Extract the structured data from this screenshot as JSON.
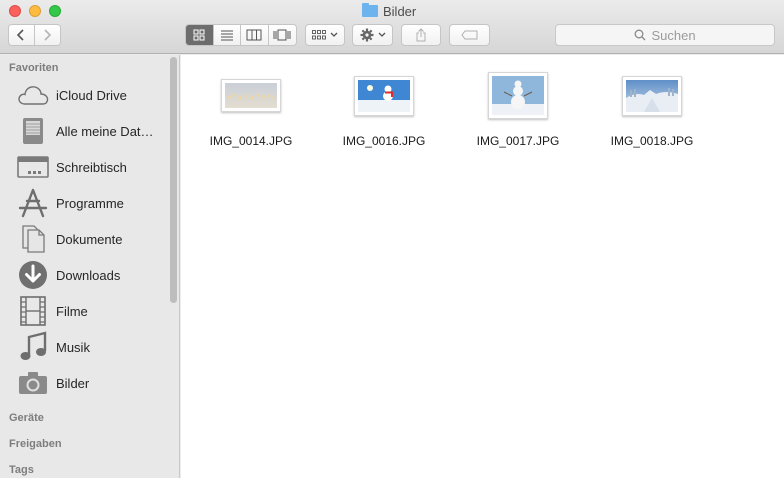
{
  "window": {
    "title": "Bilder"
  },
  "toolbar": {
    "back_icon": "chevron-left-icon",
    "forward_icon": "chevron-right-icon",
    "views": [
      "icon-view",
      "list-view",
      "column-view",
      "coverflow-view"
    ],
    "arrange_icon": "arrange-grid-icon",
    "action_icon": "gear-icon",
    "share_icon": "share-icon",
    "tag_icon": "tag-icon",
    "search_placeholder": "Suchen"
  },
  "sidebar": {
    "favorites_label": "Favoriten",
    "items": [
      {
        "label": "iCloud Drive",
        "icon": "cloud-icon"
      },
      {
        "label": "Alle meine Dat…",
        "icon": "all-files-icon"
      },
      {
        "label": "Schreibtisch",
        "icon": "desktop-icon"
      },
      {
        "label": "Programme",
        "icon": "applications-icon"
      },
      {
        "label": "Dokumente",
        "icon": "documents-icon"
      },
      {
        "label": "Downloads",
        "icon": "downloads-icon"
      },
      {
        "label": "Filme",
        "icon": "movies-icon"
      },
      {
        "label": "Musik",
        "icon": "music-icon"
      },
      {
        "label": "Bilder",
        "icon": "camera-icon"
      }
    ],
    "devices_label": "Geräte",
    "shared_label": "Freigaben",
    "tags_label": "Tags"
  },
  "files": [
    {
      "name": "IMG_0014.JPG",
      "orientation": "landscape"
    },
    {
      "name": "IMG_0016.JPG",
      "orientation": "landscape"
    },
    {
      "name": "IMG_0017.JPG",
      "orientation": "square"
    },
    {
      "name": "IMG_0018.JPG",
      "orientation": "landscape"
    }
  ]
}
